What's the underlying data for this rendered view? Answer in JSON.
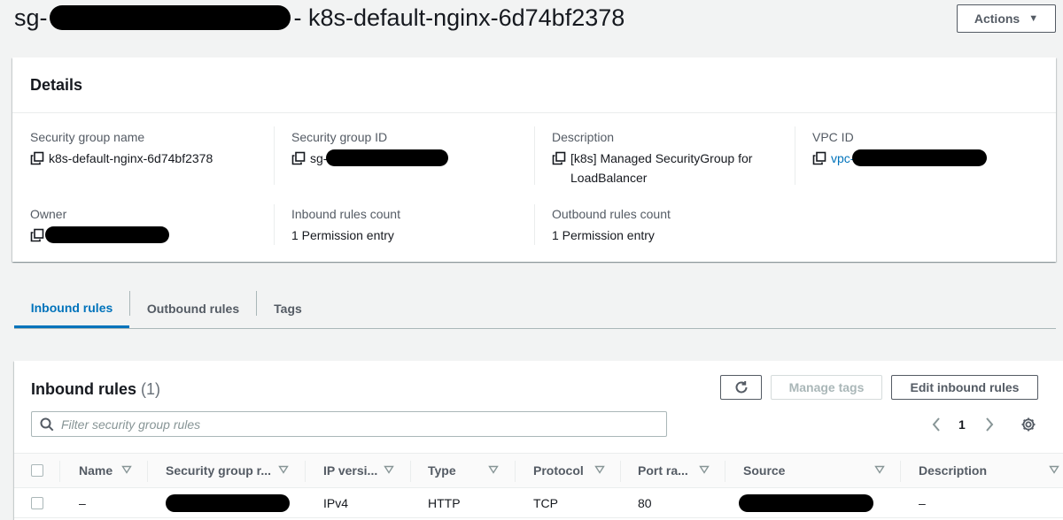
{
  "header": {
    "title_prefix": "sg-",
    "title_suffix": "- k8s-default-nginx-6d74bf2378",
    "actions_label": "Actions"
  },
  "details": {
    "heading": "Details",
    "fields": {
      "sg_name": {
        "label": "Security group name",
        "value": "k8s-default-nginx-6d74bf2378"
      },
      "sg_id": {
        "label": "Security group ID",
        "value": "sg-"
      },
      "description": {
        "label": "Description",
        "value": "[k8s] Managed SecurityGroup for LoadBalancer"
      },
      "vpc_id": {
        "label": "VPC ID",
        "value": "vpc-"
      },
      "owner": {
        "label": "Owner"
      },
      "inbound_count": {
        "label": "Inbound rules count",
        "value": "1 Permission entry"
      },
      "outbound_count": {
        "label": "Outbound rules count",
        "value": "1 Permission entry"
      }
    }
  },
  "tabs": [
    {
      "label": "Inbound rules",
      "active": true
    },
    {
      "label": "Outbound rules",
      "active": false
    },
    {
      "label": "Tags",
      "active": false
    }
  ],
  "inbound_rules": {
    "title": "Inbound rules",
    "count": "(1)",
    "buttons": {
      "manage_tags": "Manage tags",
      "edit": "Edit inbound rules"
    },
    "filter_placeholder": "Filter security group rules",
    "page": "1",
    "columns": [
      "Name",
      "Security group r...",
      "IP versi...",
      "Type",
      "Protocol",
      "Port ra...",
      "Source",
      "Description"
    ],
    "rows": [
      {
        "name": "–",
        "security_group_rule_id": "",
        "ip_version": "IPv4",
        "type": "HTTP",
        "protocol": "TCP",
        "port_range": "80",
        "source": "",
        "description": "–"
      }
    ]
  },
  "colors": {
    "link": "#0073bb",
    "background": "#f2f3f3",
    "text": "#16191f",
    "muted": "#545b64"
  }
}
